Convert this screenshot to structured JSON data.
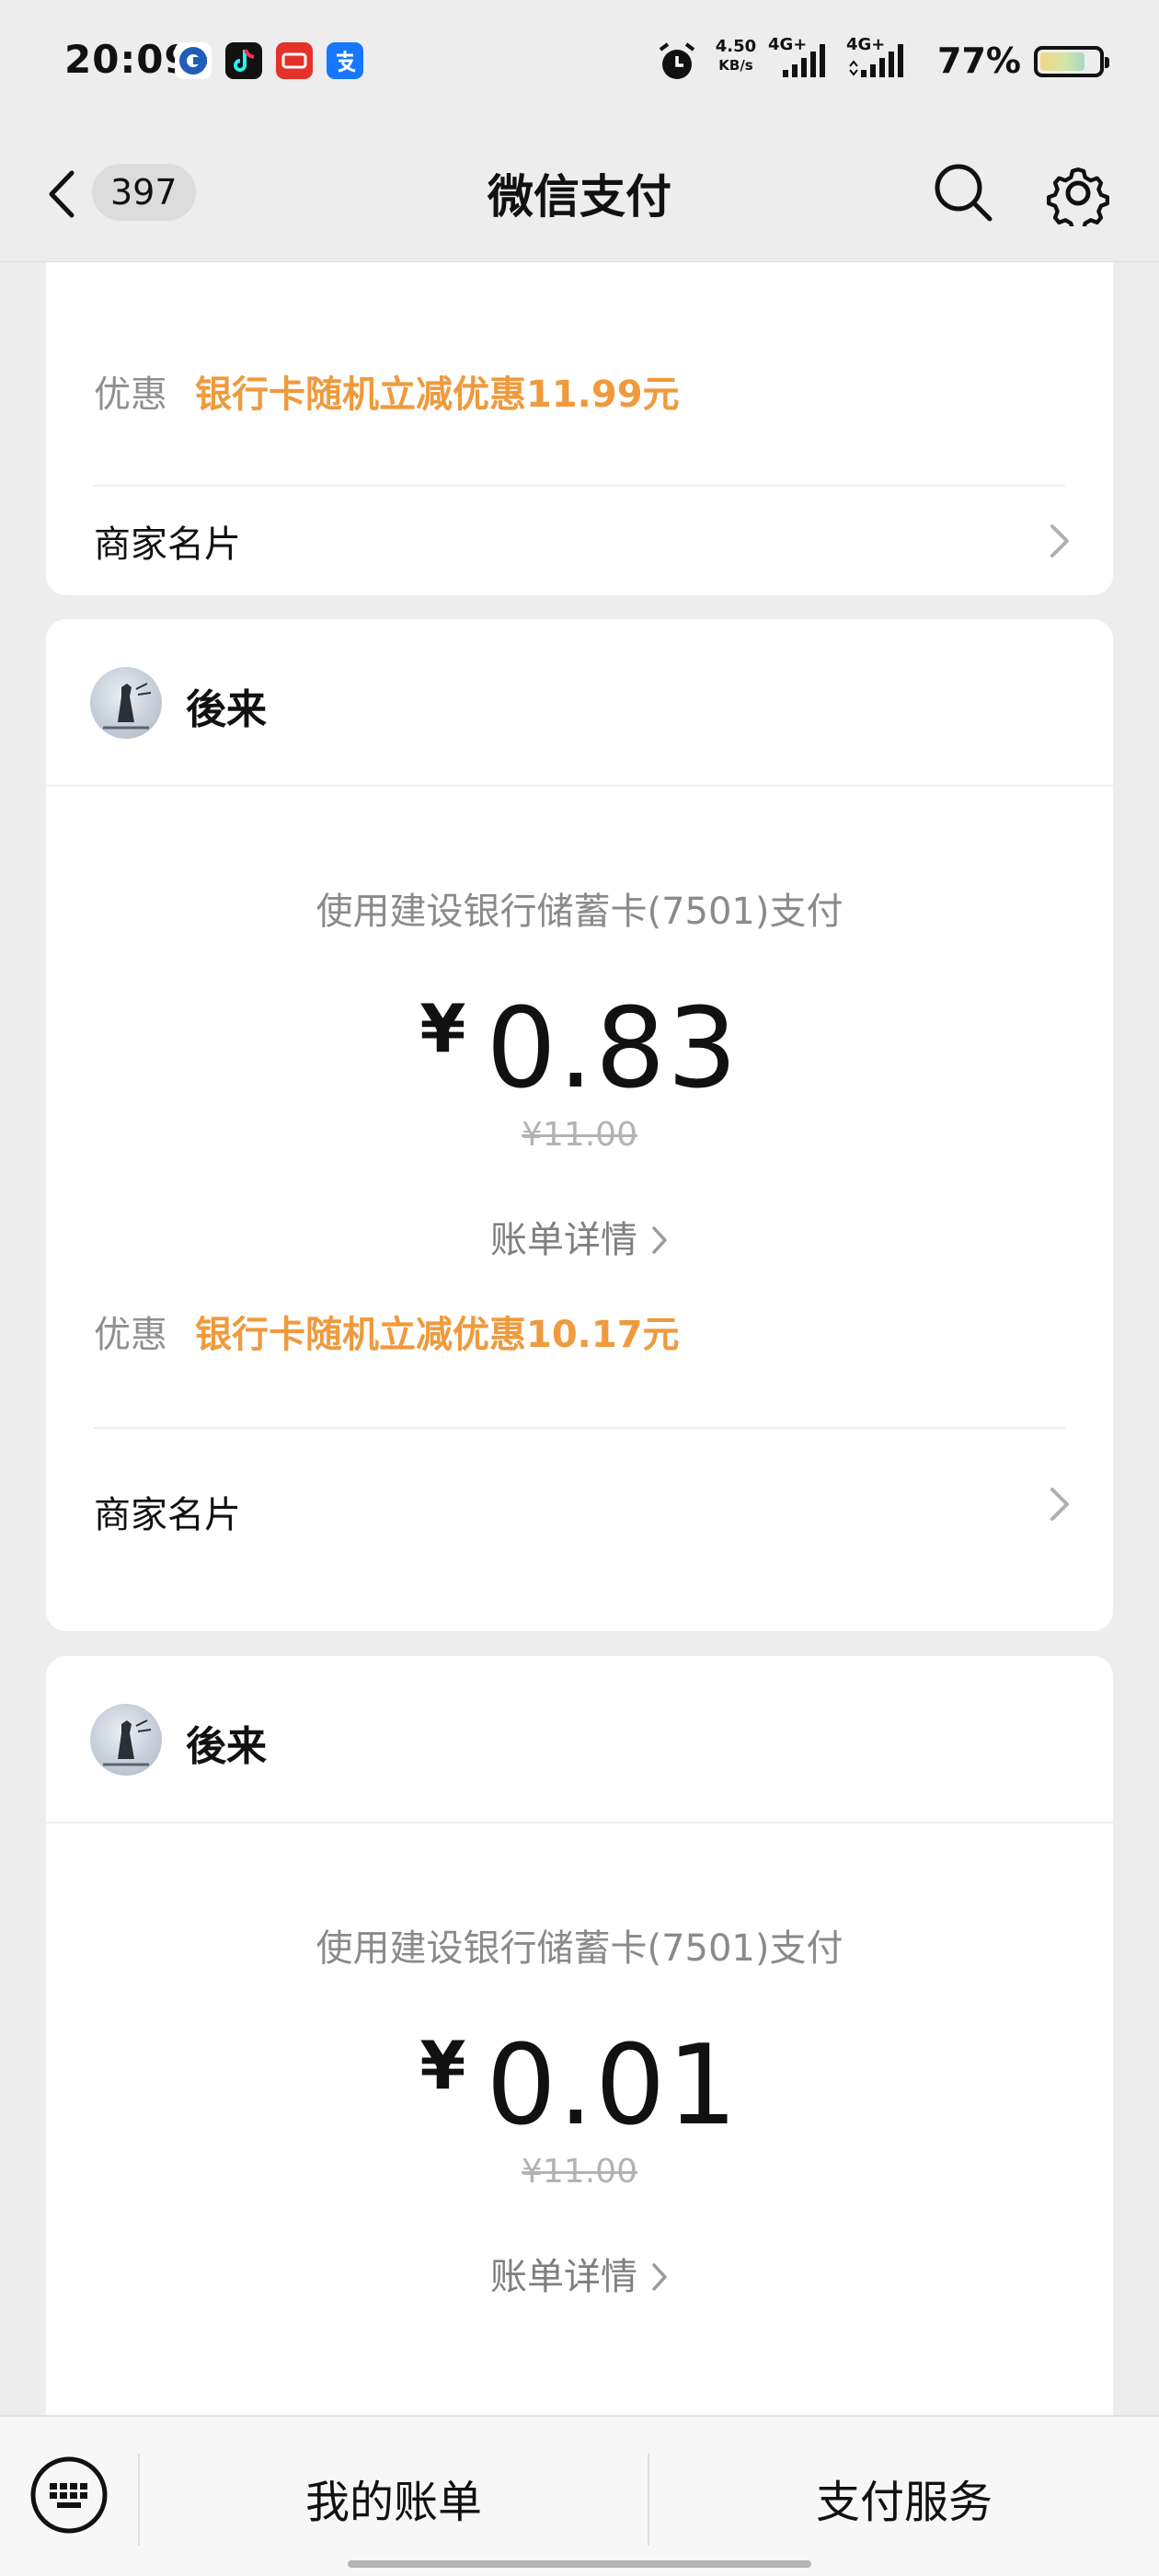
{
  "status_bar": {
    "time": "20:09",
    "net_speed_value": "4.50",
    "net_speed_unit": "KB/s",
    "signal1_label": "4G+",
    "signal2_label": "4G+",
    "battery_percent": "77%",
    "battery_level": 0.77,
    "app_icons": [
      "bank-app-icon",
      "douyin-icon",
      "yunshanfu-icon",
      "alipay-icon"
    ]
  },
  "nav": {
    "unread_count": "397",
    "title": "微信支付"
  },
  "card1": {
    "discount_label": "优惠",
    "discount_value": "银行卡随机立减优惠11.99元",
    "merchant_card_label": "商家名片"
  },
  "card2": {
    "merchant_name": "後来",
    "pay_method": "使用建设银行储蓄卡(7501)支付",
    "currency": "¥",
    "amount": "0.83",
    "original_price": "¥11.00",
    "bill_detail": "账单详情",
    "discount_label": "优惠",
    "discount_value": "银行卡随机立减优惠10.17元",
    "merchant_card_label": "商家名片"
  },
  "card3": {
    "merchant_name": "後来",
    "pay_method": "使用建设银行储蓄卡(7501)支付",
    "currency": "¥",
    "amount": "0.01",
    "original_price": "¥11.00",
    "bill_detail": "账单详情"
  },
  "bottom_bar": {
    "my_bills": "我的账单",
    "pay_services": "支付服务"
  },
  "colors": {
    "discount": "#ef9a3c",
    "background": "#ededed"
  }
}
